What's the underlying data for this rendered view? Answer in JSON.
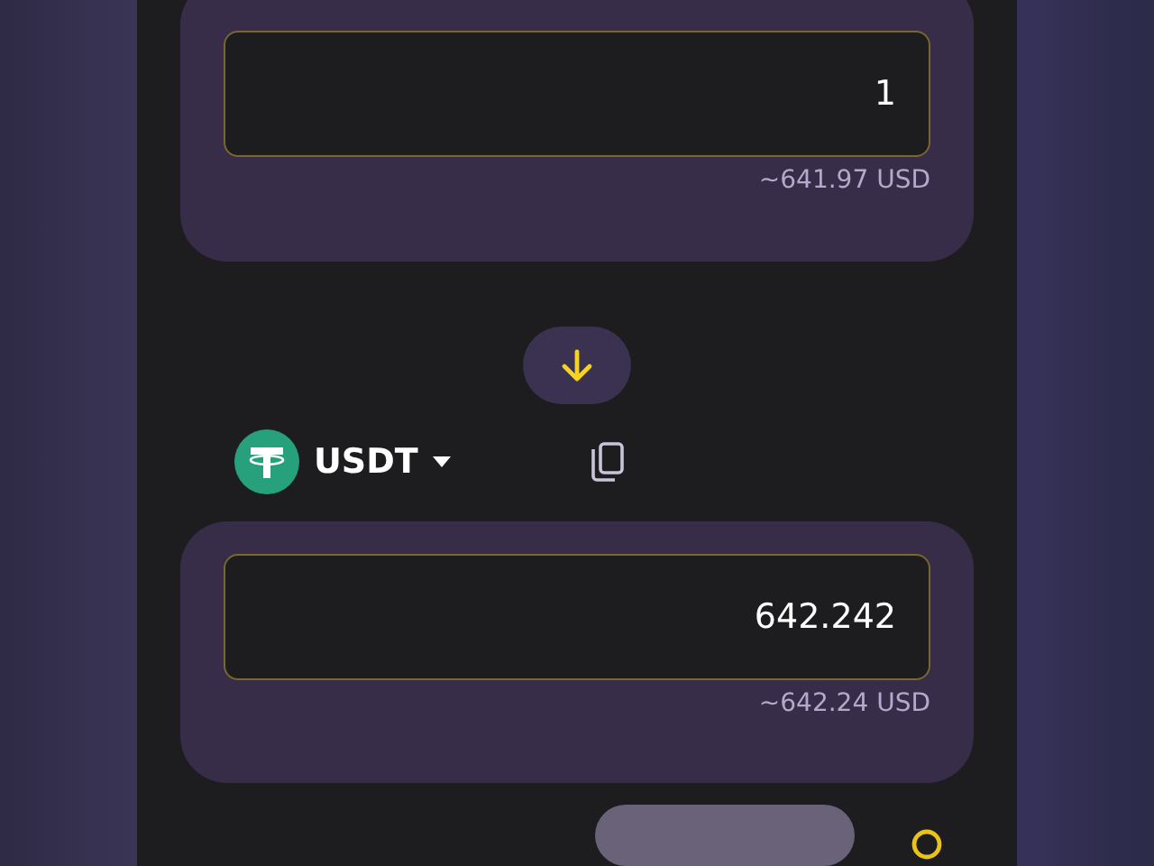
{
  "from": {
    "amount": "1",
    "usd_value": "~641.97 USD"
  },
  "to": {
    "token": "USDT",
    "amount": "642.242",
    "usd_value": "~642.24 USD"
  }
}
